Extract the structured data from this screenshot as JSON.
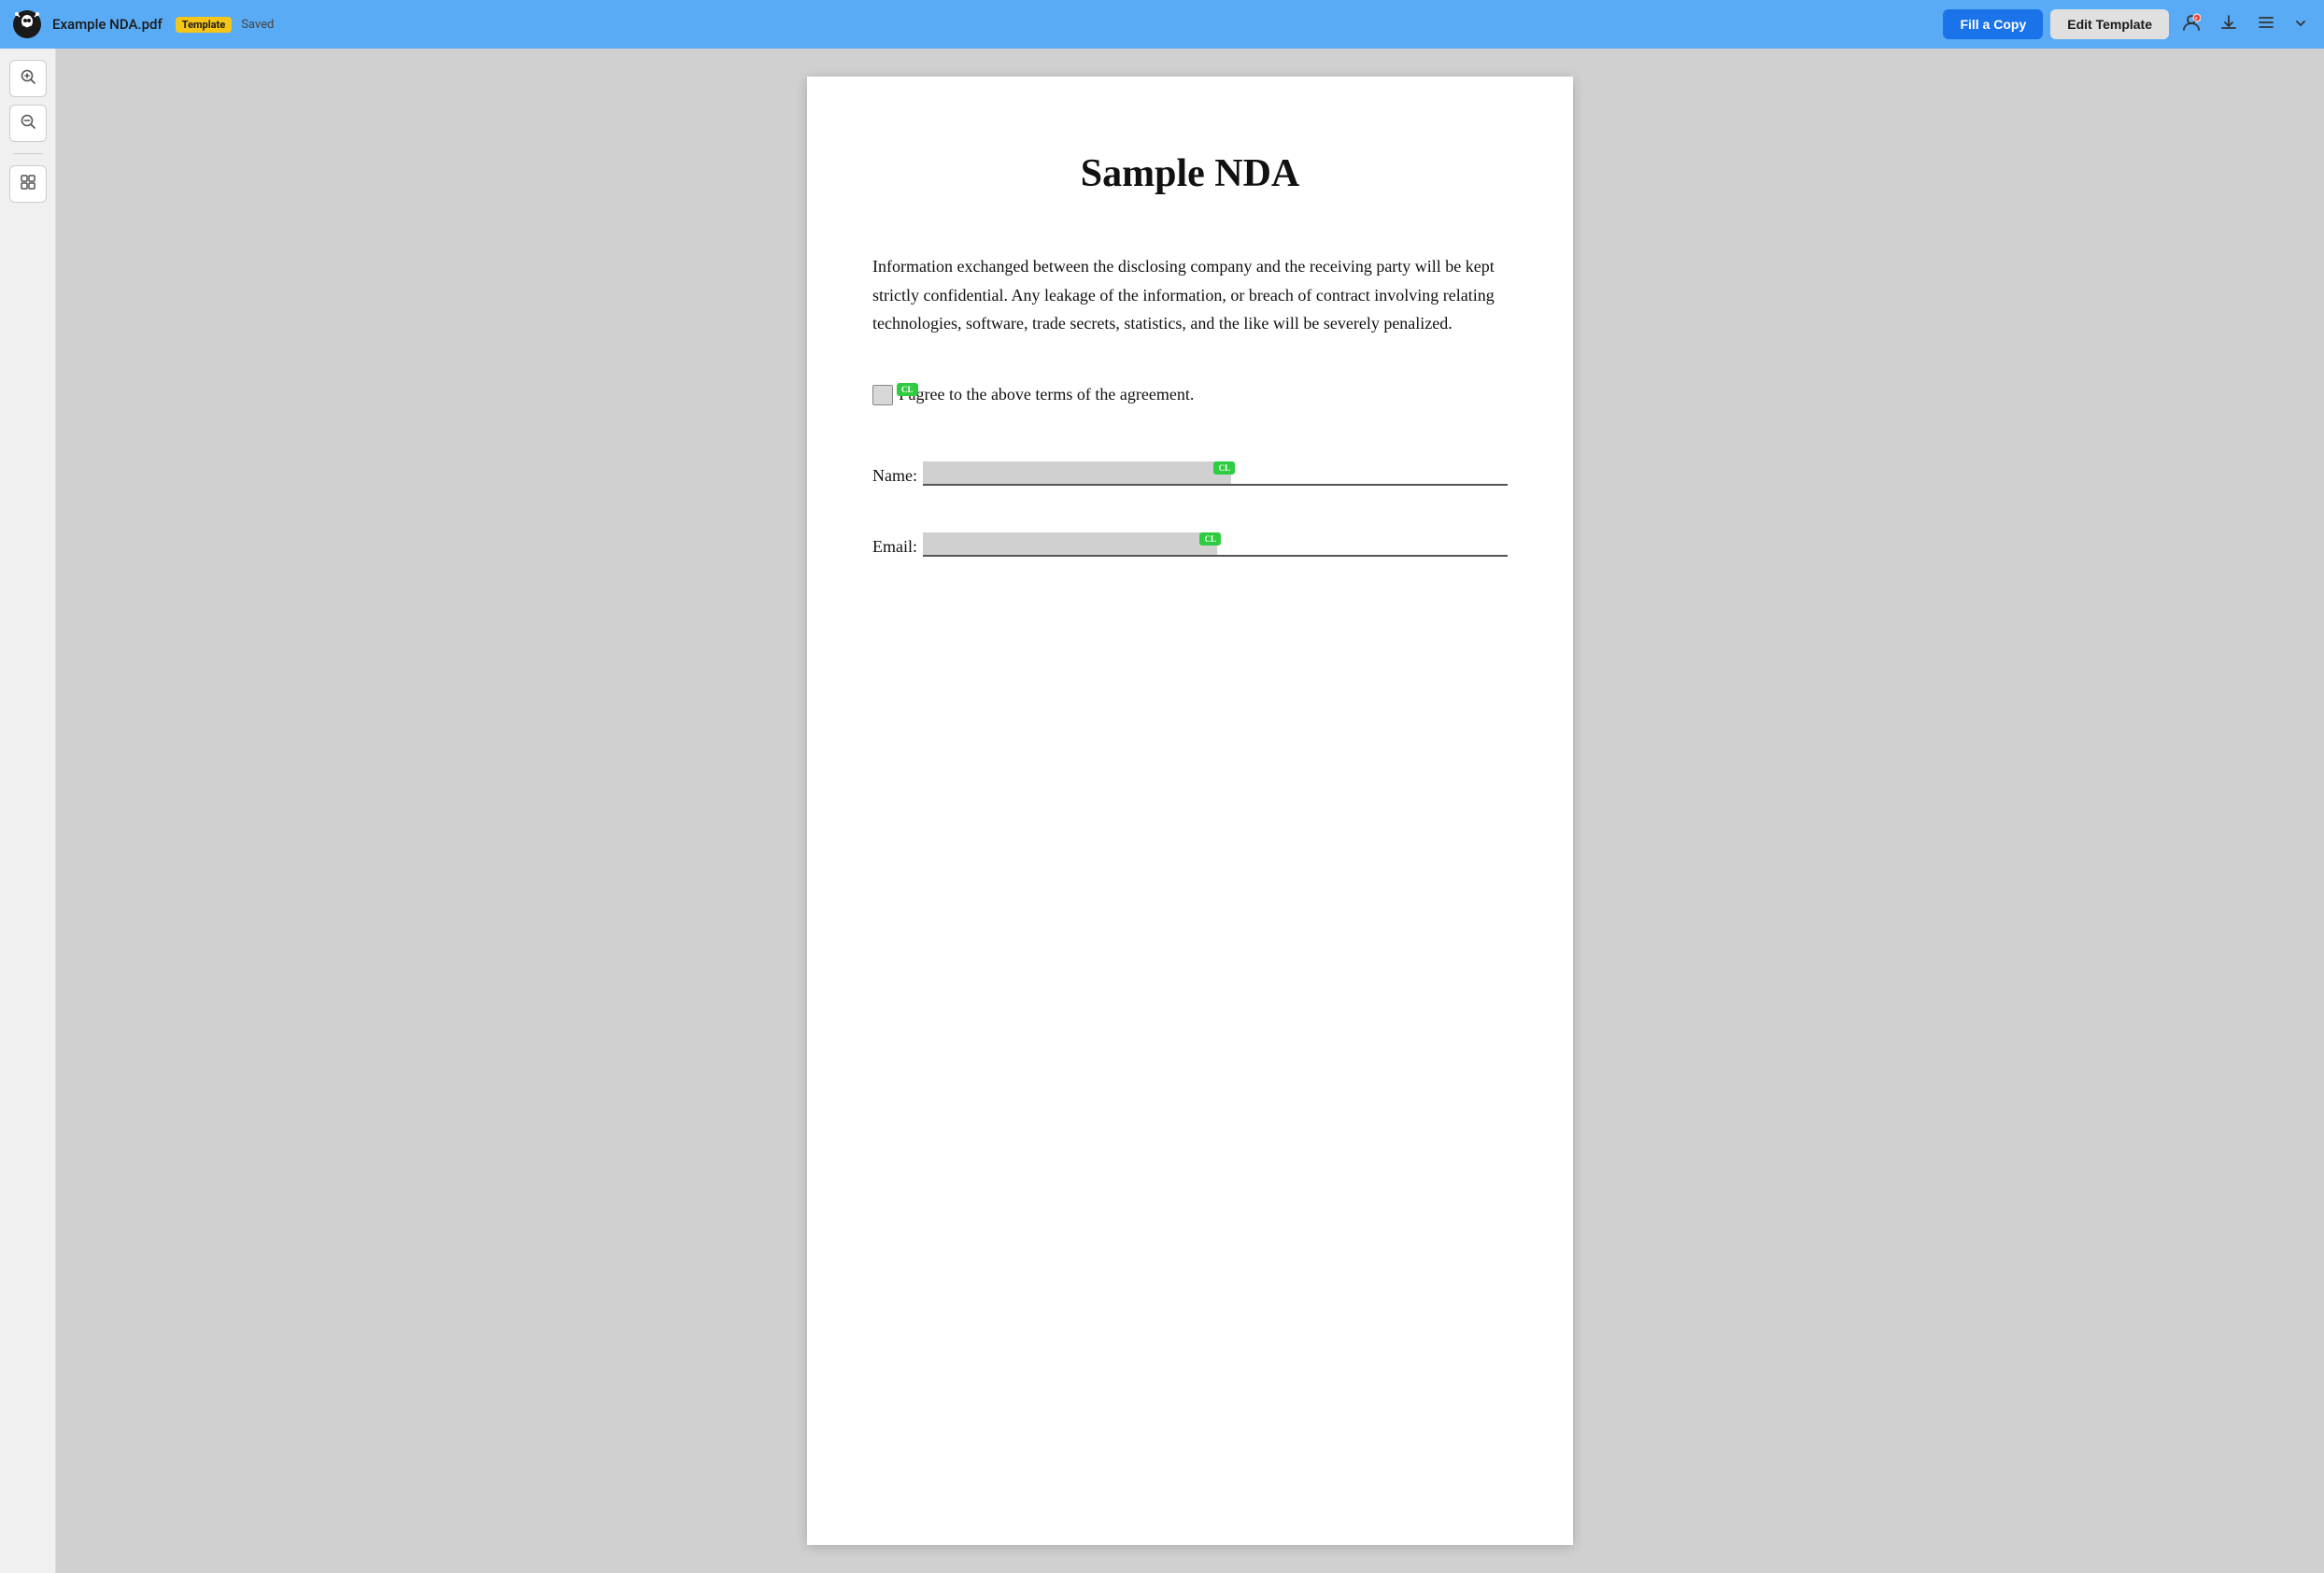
{
  "topbar": {
    "logo_alt": "app-logo",
    "filename": "Example NDA.pdf",
    "badge": "Template",
    "saved_label": "Saved",
    "fill_copy_label": "Fill a Copy",
    "edit_template_label": "Edit Template",
    "icons": {
      "user": "👤",
      "download": "⬇",
      "menu": "☰",
      "chevron": "▾"
    }
  },
  "toolbar": {
    "zoom_in": "+",
    "zoom_out": "−",
    "grid": "⊞"
  },
  "document": {
    "title": "Sample NDA",
    "body": "Information exchanged between the disclosing company and the receiving party will be kept strictly confidential. Any leakage of the information, or breach of contract involving relating technologies, software, trade secrets, statistics, and the like will be severely penalized.",
    "checkbox_label": "I agree to the above terms of the agreement.",
    "name_label": "Name:",
    "email_label": "Email:",
    "cl_badge": "CL"
  }
}
